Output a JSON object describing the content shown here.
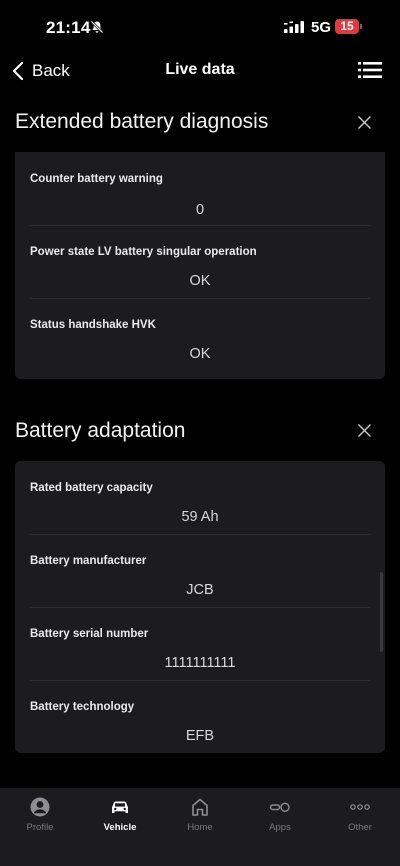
{
  "status_bar": {
    "time": "21:14",
    "network": "5G",
    "battery": "15"
  },
  "nav": {
    "back_label": "Back",
    "title": "Live data"
  },
  "sections": [
    {
      "title": "Extended battery diagnosis",
      "rows": [
        {
          "label": "Counter battery warning",
          "value": "0"
        },
        {
          "label": "Power state LV battery singular operation",
          "value": "OK"
        },
        {
          "label": "Status handshake HVK",
          "value": "OK"
        }
      ]
    },
    {
      "title": "Battery adaptation",
      "rows": [
        {
          "label": "Rated battery capacity",
          "value": "59 Ah"
        },
        {
          "label": "Battery manufacturer",
          "value": "JCB"
        },
        {
          "label": "Battery serial number",
          "value": "1111111111"
        },
        {
          "label": "Battery technology",
          "value": "EFB"
        }
      ]
    }
  ],
  "tab_bar": {
    "active": "vehicle",
    "tabs": [
      {
        "label": "Profile",
        "icon": "profile-icon"
      },
      {
        "label": "Vehicle",
        "icon": "car-icon"
      },
      {
        "label": "Home",
        "icon": "home-icon"
      },
      {
        "label": "Apps",
        "icon": "apps-icon"
      },
      {
        "label": "Other",
        "icon": "more-icon"
      }
    ]
  }
}
